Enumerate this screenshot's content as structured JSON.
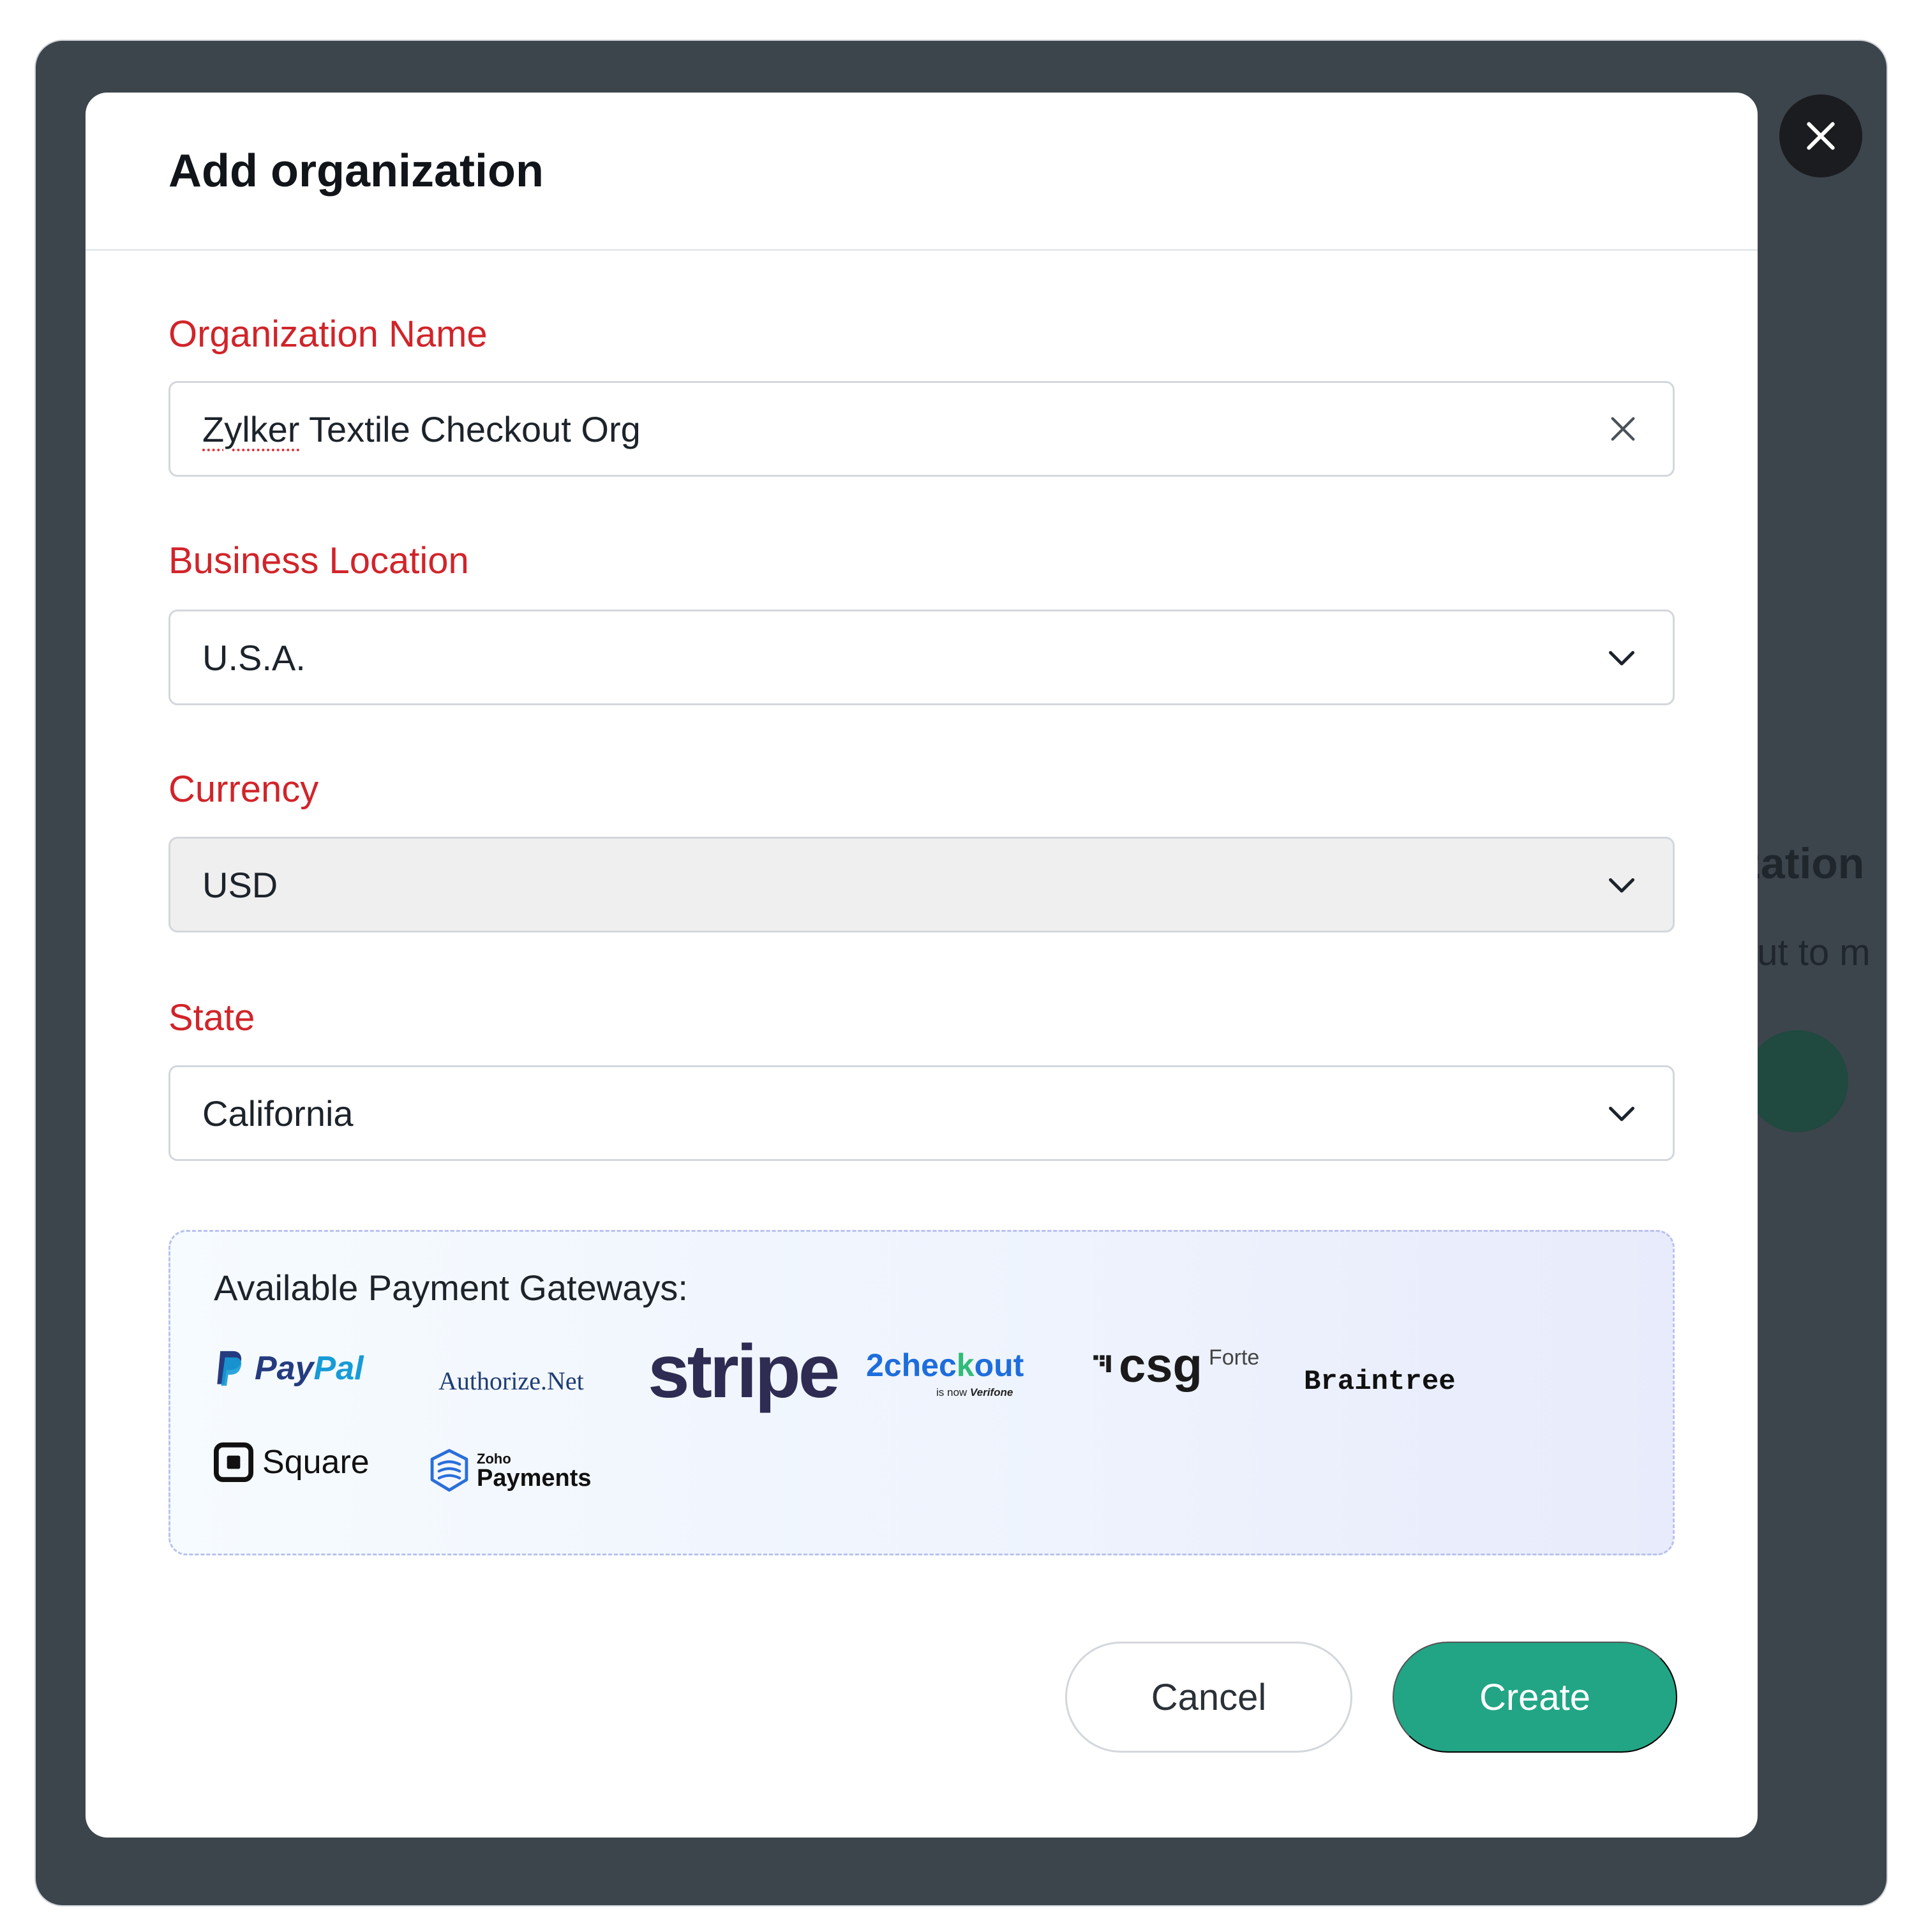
{
  "background": {
    "partial_title": "ization",
    "partial_subtitle": "out to m"
  },
  "modal": {
    "title": "Add organization",
    "fields": {
      "org_name": {
        "label": "Organization Name",
        "value_underlined": "Zylker",
        "value_rest": " Textile Checkout Org"
      },
      "business_location": {
        "label": "Business Location",
        "value": "U.S.A."
      },
      "currency": {
        "label": "Currency",
        "value": "USD",
        "disabled": true
      },
      "state": {
        "label": "State",
        "value": "California"
      }
    },
    "gateways": {
      "title": "Available Payment Gateways:",
      "paypal": {
        "pay": "Pay",
        "pal": "Pal"
      },
      "authorize_net": "Authorize.Net",
      "stripe": "stripe",
      "twocheckout": {
        "two": "2",
        "check": "chec",
        "k": "k",
        "out": "out",
        "sub_prefix": "is now ",
        "sub_brand": "Verifone"
      },
      "csg": {
        "name": "csg",
        "forte": "Forte"
      },
      "braintree": "Braintree",
      "square": "Square",
      "zoho_payments": {
        "zoho": "Zoho",
        "payments": "Payments"
      }
    },
    "buttons": {
      "cancel": "Cancel",
      "create": "Create"
    }
  },
  "colors": {
    "overlay": "#3c444c",
    "label_red": "#d1242a",
    "create_green": "#21a585"
  },
  "icons": {
    "close": "close-icon",
    "clear": "clear-icon",
    "dropdown": "chevron-down-icon"
  }
}
